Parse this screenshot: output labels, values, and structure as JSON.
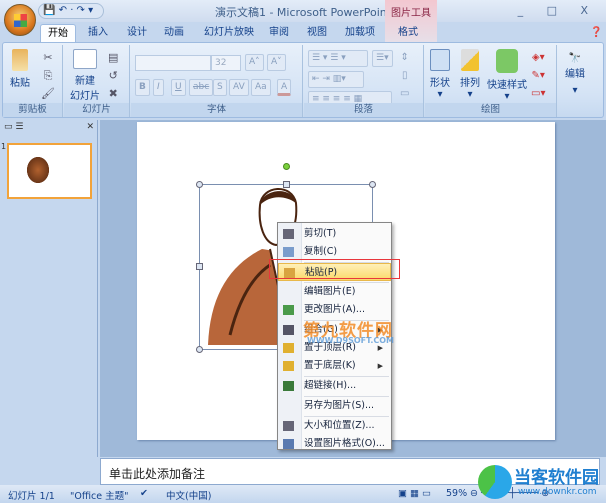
{
  "app": {
    "title": "演示文稿1 - Microsoft PowerPoint",
    "contextual_tab_group": "图片工具",
    "window_controls": "_ □ X"
  },
  "qat": {
    "items": "💾 ↶ · ↷ ▾"
  },
  "tabs": [
    "开始",
    "插入",
    "设计",
    "动画",
    "幻灯片放映",
    "审阅",
    "视图",
    "加载项",
    "格式"
  ],
  "active_tab": "开始",
  "ribbon": {
    "clipboard": {
      "label": "剪贴板",
      "paste": "粘贴"
    },
    "slides": {
      "label": "幻灯片",
      "new_slide": "新建",
      "new_slide2": "幻灯片 ▾"
    },
    "font": {
      "label": "字体",
      "font_name": "",
      "font_size": "32",
      "bold": "B",
      "italic": "I",
      "underline": "U",
      "strike": "abc",
      "shadow": "S",
      "spacing": "AV",
      "case": "Aa",
      "color": "A",
      "grow": "A˄",
      "shrink": "A˅"
    },
    "paragraph": {
      "label": "段落"
    },
    "drawing": {
      "label": "绘图",
      "shapes": "形状",
      "arrange": "排列",
      "quick_styles": "快速样式"
    },
    "editing": {
      "label": "编辑"
    }
  },
  "context_menu": {
    "items": [
      {
        "label": "剪切(T)",
        "icon": "scissors-icon"
      },
      {
        "label": "复制(C)",
        "icon": "copy-icon"
      },
      {
        "label": "粘贴(P)",
        "icon": "paste-icon",
        "highlighted": true
      },
      {
        "label": "编辑图片(E)",
        "icon": ""
      },
      {
        "label": "更改图片(A)...",
        "icon": "change-picture-icon"
      },
      {
        "label": "组合(G)",
        "icon": "group-icon",
        "submenu": true
      },
      {
        "label": "置于顶层(R)",
        "icon": "bring-front-icon",
        "submenu": true
      },
      {
        "label": "置于底层(K)",
        "icon": "send-back-icon",
        "submenu": true
      },
      {
        "label": "超链接(H)...",
        "icon": "hyperlink-icon"
      },
      {
        "label": "另存为图片(S)...",
        "icon": ""
      },
      {
        "label": "大小和位置(Z)...",
        "icon": "size-icon"
      },
      {
        "label": "设置图片格式(O)...",
        "icon": "format-picture-icon"
      }
    ]
  },
  "slide_panel": {
    "thumbnail_number": "1"
  },
  "notes": {
    "placeholder": "单击此处添加备注"
  },
  "status": {
    "slide": "幻灯片 1/1",
    "theme": "\"Office 主题\"",
    "language": "中文(中国)",
    "zoom": "59%"
  },
  "watermarks": {
    "center": "第九软件网",
    "center_url": "WWW.D9SOFT.COM",
    "logo": "当客软件园",
    "logo_url": "www.downkr.com"
  },
  "colors": {
    "accent": "#f2a33a",
    "highlight_box": "#e8363c"
  }
}
